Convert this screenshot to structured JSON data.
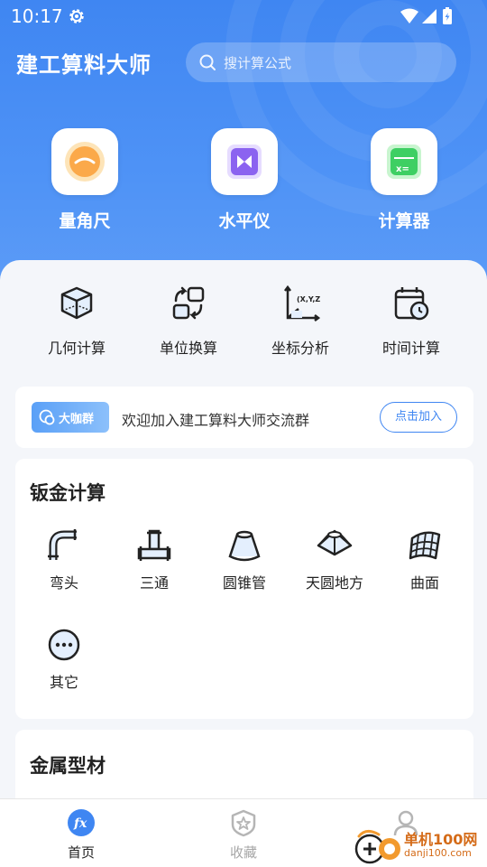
{
  "status_bar": {
    "time": "10:17"
  },
  "header": {
    "app_title": "建工算料大师",
    "search_placeholder": "搜计算公式"
  },
  "tools": [
    {
      "label": "量角尺"
    },
    {
      "label": "水平仪"
    },
    {
      "label": "计算器"
    }
  ],
  "quick_menu": [
    {
      "label": "几何计算"
    },
    {
      "label": "单位换算"
    },
    {
      "label": "坐标分析"
    },
    {
      "label": "时间计算"
    }
  ],
  "coord_glyph": "(X,Y,Z)",
  "banner": {
    "badge": "大咖群",
    "text": "欢迎加入建工算料大师交流群",
    "join_label": "点击加入"
  },
  "sheet_metal": {
    "title": "钣金计算",
    "items": [
      {
        "label": "弯头"
      },
      {
        "label": "三通"
      },
      {
        "label": "圆锥管"
      },
      {
        "label": "天圆地方"
      },
      {
        "label": "曲面"
      },
      {
        "label": "其它"
      }
    ]
  },
  "metal_profiles": {
    "title": "金属型材"
  },
  "tabbar": {
    "tabs": [
      {
        "label": "首页"
      },
      {
        "label": "收藏"
      }
    ]
  },
  "watermark": {
    "line1": "单机100网",
    "line2": "danji100.com"
  },
  "colors": {
    "primary": "#3f86f2",
    "tab_active": "#3f86f2",
    "tab_inactive": "#a6a6a6"
  }
}
